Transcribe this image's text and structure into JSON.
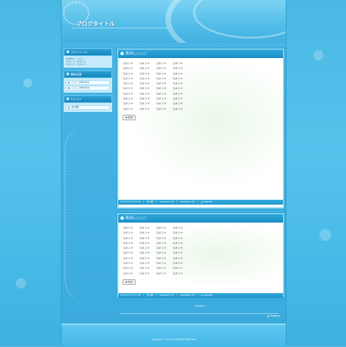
{
  "header": {
    "blog_title": "ブログタイトル"
  },
  "sidebar": {
    "profile": {
      "title": "プロフィール",
      "lines": [
        "Author：○○○",
        "コメント コメント",
        "コメント コメント"
      ]
    },
    "recent": {
      "title": "最新記事",
      "items": [
        "○○○ (MM/DD)",
        "○○○ (MM/DD)"
      ]
    },
    "category": {
      "title": "カテゴリ",
      "items": [
        "未分類"
      ]
    }
  },
  "posts": [
    {
      "title": "見出し○○○",
      "rows": [
        [
          "コメント",
          "コメント",
          "コメント",
          "コメント"
        ],
        [
          "コメント",
          "コメント",
          "コメント",
          "コメント"
        ],
        [
          "コメント",
          "コメント",
          "コメント",
          "コメント"
        ],
        [
          "コメント",
          "コメント",
          "コメント",
          "コメント"
        ],
        [
          "コメント",
          "コメント",
          "コメント",
          "コメント"
        ],
        [
          "コメント",
          "コメント",
          "コメント",
          "コメント"
        ],
        [
          "コメント",
          "コメント",
          "コメント",
          "コメント"
        ],
        [
          "コメント",
          "コメント",
          "コメント",
          "コメント"
        ],
        [
          "コメント",
          "コメント",
          "コメント",
          "コメント"
        ],
        [
          "コメント",
          "コメント",
          "コメント",
          "コメント"
        ]
      ],
      "clap": "拍手",
      "footer": [
        "2012-07-10 20:38",
        "未分類",
        "comment (0)",
        "trackback (0)",
        "▲ Pagetop"
      ]
    },
    {
      "title": "見出し○○○",
      "rows": [
        [
          "コメント",
          "コメント",
          "コメント",
          "コメント"
        ],
        [
          "コメント",
          "コメント",
          "コメント",
          "コメント"
        ],
        [
          "コメント",
          "コメント",
          "コメント",
          "コメント"
        ],
        [
          "コメント",
          "コメント",
          "コメント",
          "コメント"
        ],
        [
          "コメント",
          "コメント",
          "コメント",
          "コメント"
        ],
        [
          "コメント",
          "コメント",
          "コメント",
          "コメント"
        ],
        [
          "コメント",
          "コメント",
          "コメント",
          "コメント"
        ],
        [
          "コメント",
          "コメント",
          "コメント",
          "コメント"
        ],
        [
          "コメント",
          "コメント",
          "コメント",
          "コメント"
        ],
        [
          "コメント",
          "コメント",
          "コメント",
          "コメント"
        ]
      ],
      "clap": "拍手",
      "footer": [
        "2012-07-10 21:18",
        "未分類",
        "comment (0)",
        "trackback (0)",
        "▲ Pagetop"
      ]
    }
  ],
  "pager": "| HOME |",
  "pagetop": "▲ Pagetop",
  "footer": {
    "copyright": "Copyright © ○○○○ All Rights Reserved."
  }
}
